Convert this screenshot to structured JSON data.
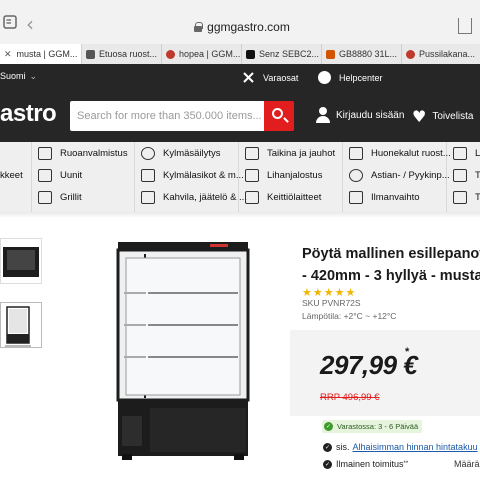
{
  "browser": {
    "url": "ggmgastro.com",
    "tabs": [
      {
        "label": "musta | GGM...",
        "active": true,
        "fav": "#888"
      },
      {
        "label": "Etuosa ruost...",
        "fav": "#555"
      },
      {
        "label": "hopea | GGM...",
        "fav": "#c0392b"
      },
      {
        "label": "Senz SEBC2...",
        "fav": "#111"
      },
      {
        "label": "GB8880 31L...",
        "fav": "#d35400"
      },
      {
        "label": "Pussilakana...",
        "fav": "#c0392b"
      }
    ]
  },
  "topstrip": {
    "language": "Suomi",
    "service": "Varaosat",
    "helpcenter": "Helpcenter"
  },
  "header": {
    "logo": "astro",
    "search_placeholder": "Search for more than 350.000 items...",
    "login": "Kirjaudu sisään",
    "wishlist": "Toivelista"
  },
  "categories": [
    {
      "label": "Ruoanvalmistus"
    },
    {
      "label": "Kylmäsäilytys"
    },
    {
      "label": "Taikina ja jauhot"
    },
    {
      "label": "Huonekalut ruost..."
    },
    {
      "label": "Lä"
    },
    {
      "label": "kkeet"
    },
    {
      "label": "Uunit"
    },
    {
      "label": "Kylmälasikot & m..."
    },
    {
      "label": "Lihanjalostus"
    },
    {
      "label": "Astian- / Pyykinp..."
    },
    {
      "label": "Te"
    },
    {
      "label": "Grillit"
    },
    {
      "label": "Kahvila, jäätelö & ..."
    },
    {
      "label": "Keittiölaitteet"
    },
    {
      "label": "Ilmanvaihto"
    },
    {
      "label": "Tu"
    }
  ],
  "product": {
    "title_line1": "Pöytä mallinen esillepanovitr",
    "title_line2": "- 420mm - 3 hyllyä - musta",
    "rating": "★★★★★",
    "sku": "SKU PVNR72S",
    "temperature": "Lämpötila: +2°C ~ +12°C",
    "price": "297,99 €",
    "price_note": "*",
    "rrp": "RRP 496,99 €",
    "stock": "Varastossa: 3 - 6 Päivää",
    "guarantee_prefix": "sis.",
    "guarantee_link": "Alhaisimman hinnan hintatakuu",
    "shipping": "Ilmainen toimitus",
    "shipping_note": "**",
    "quantity_label": "Määrä"
  }
}
